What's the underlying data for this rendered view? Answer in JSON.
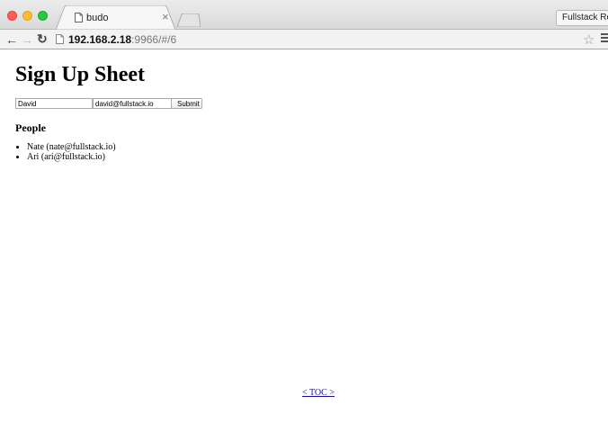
{
  "browser": {
    "tab": {
      "title": "budo",
      "close": "×"
    },
    "profile_button": "Fullstack React",
    "address_bar": {
      "host": "192.168.2.18",
      "rest": ":9966/#/6"
    },
    "icons": [
      "page-icon",
      "back-arrow-icon",
      "forward-arrow-icon",
      "reload-icon",
      "bookmark-star-icon",
      "menu-icon"
    ]
  },
  "page": {
    "title": "Sign Up Sheet",
    "form": {
      "name_value": "David",
      "email_value": "david@fullstack.io",
      "submit_label": "Submit"
    },
    "people_heading": "People",
    "people": [
      "Nate (nate@fullstack.io)",
      "Ari (ari@fullstack.io)"
    ],
    "toc_link": "< TOC >"
  }
}
